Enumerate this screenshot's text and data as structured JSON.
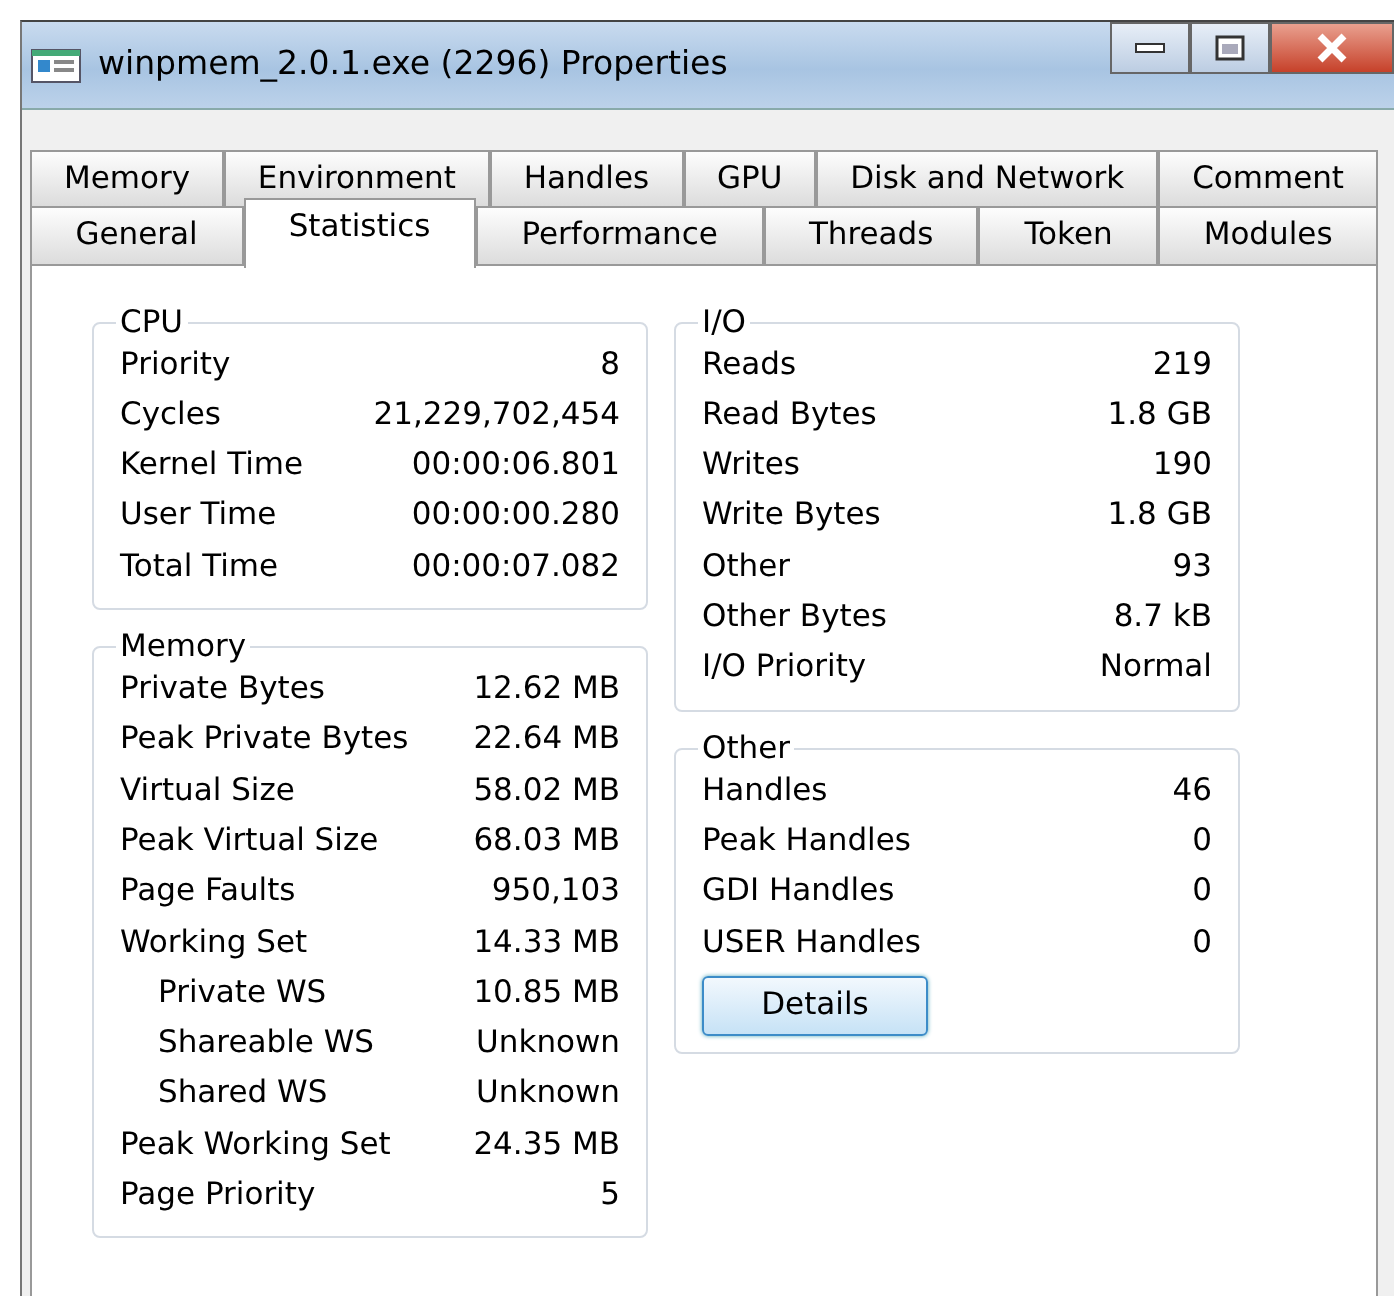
{
  "window": {
    "title": "winpmem_2.0.1.exe (2296) Properties"
  },
  "tab_rows": [
    [
      {
        "label": "Memory",
        "selected": false
      },
      {
        "label": "Environment",
        "selected": false
      },
      {
        "label": "Handles",
        "selected": false
      },
      {
        "label": "GPU",
        "selected": false
      },
      {
        "label": "Disk and Network",
        "selected": false
      },
      {
        "label": "Comment",
        "selected": false
      }
    ],
    [
      {
        "label": "General",
        "selected": false
      },
      {
        "label": "Statistics",
        "selected": true
      },
      {
        "label": "Performance",
        "selected": false
      },
      {
        "label": "Threads",
        "selected": false
      },
      {
        "label": "Token",
        "selected": false
      },
      {
        "label": "Modules",
        "selected": false
      }
    ]
  ],
  "columns": [
    {
      "groups": [
        {
          "title": "CPU",
          "rows": [
            {
              "label": "Priority",
              "value": "8"
            },
            {
              "label": "Cycles",
              "value": "21,229,702,454"
            },
            {
              "label": "Kernel Time",
              "value": "00:00:06.801"
            },
            {
              "label": "User Time",
              "value": "00:00:00.280"
            },
            {
              "label": "Total Time",
              "value": "00:00:07.082"
            }
          ]
        },
        {
          "title": "Memory",
          "rows": [
            {
              "label": "Private Bytes",
              "value": "12.62 MB"
            },
            {
              "label": "Peak Private Bytes",
              "value": "22.64 MB"
            },
            {
              "label": "Virtual Size",
              "value": "58.02 MB"
            },
            {
              "label": "Peak Virtual Size",
              "value": "68.03 MB"
            },
            {
              "label": "Page Faults",
              "value": "950,103"
            },
            {
              "label": "Working Set",
              "value": "14.33 MB",
              "children": [
                {
                  "label": "Private WS",
                  "value": "10.85 MB"
                },
                {
                  "label": "Shareable WS",
                  "value": "Unknown"
                },
                {
                  "label": "Shared WS",
                  "value": "Unknown"
                }
              ]
            },
            {
              "label": "Peak Working Set",
              "value": "24.35 MB"
            },
            {
              "label": "Page Priority",
              "value": "5"
            }
          ]
        }
      ]
    },
    {
      "groups": [
        {
          "title": "I/O",
          "rows": [
            {
              "label": "Reads",
              "value": "219"
            },
            {
              "label": "Read Bytes",
              "value": "1.8 GB"
            },
            {
              "label": "Writes",
              "value": "190"
            },
            {
              "label": "Write Bytes",
              "value": "1.8 GB"
            },
            {
              "label": "Other",
              "value": "93"
            },
            {
              "label": "Other Bytes",
              "value": "8.7 kB"
            },
            {
              "label": "I/O Priority",
              "value": "Normal"
            }
          ]
        },
        {
          "title": "Other",
          "rows": [
            {
              "label": "Handles",
              "value": "46"
            },
            {
              "label": "Peak Handles",
              "value": "0"
            },
            {
              "label": "GDI Handles",
              "value": "0"
            },
            {
              "label": "USER Handles",
              "value": "0"
            }
          ],
          "button": "Details"
        }
      ]
    }
  ]
}
